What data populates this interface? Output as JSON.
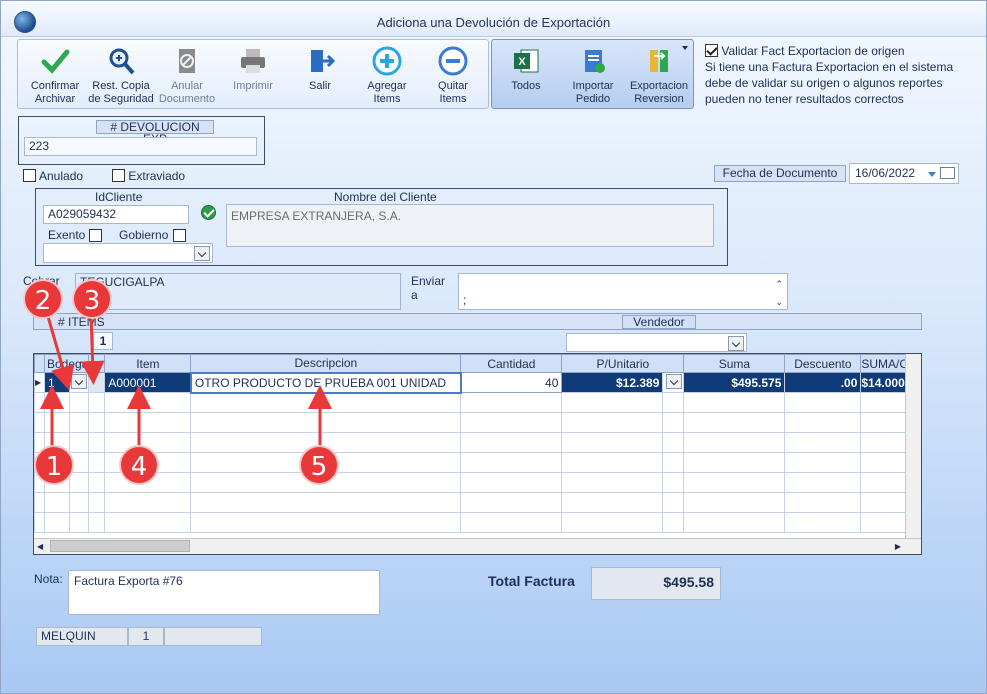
{
  "window": {
    "title": "Adiciona una Devolución de Exportación"
  },
  "toolbar": {
    "buttons": [
      {
        "label": "Confirmar\nArchivar",
        "icon": "check-icon"
      },
      {
        "label": "Rest. Copia\nde Seguridad",
        "icon": "magnify-icon"
      },
      {
        "label": "Anular\nDocumento",
        "icon": "void-document-icon"
      },
      {
        "label": "Imprimir",
        "icon": "printer-icon"
      },
      {
        "label": "Salir",
        "icon": "exit-door-icon"
      },
      {
        "label": "Agregar\nItems",
        "icon": "add-circle-icon"
      },
      {
        "label": "Quitar\nItems",
        "icon": "remove-circle-icon"
      }
    ],
    "buttons2": [
      {
        "label": "Todos",
        "icon": "excel-icon"
      },
      {
        "label": "Importar\nPedido",
        "icon": "import-order-icon"
      },
      {
        "label": "Exportacion\nReversion",
        "icon": "export-reversion-icon"
      }
    ]
  },
  "validate": {
    "checkbox_label": "Validar Fact Exportacion de origen",
    "note": "Si tiene una Factura Exportacion en el sistema debe de validar su origen o algunos reportes pueden no tener resultados correctos"
  },
  "devolucion": {
    "label": "# DEVOLUCION EXP",
    "value": "223"
  },
  "flags": {
    "anulado": "Anulado",
    "extraviado": "Extraviado"
  },
  "fecha": {
    "label": "Fecha de  Documento",
    "value": "16/06/2022"
  },
  "cliente": {
    "id_label": "IdCliente",
    "id_value": "A029059432",
    "name_label": "Nombre del Cliente",
    "name_value": "EMPRESA EXTRANJERA, S.A.",
    "exento": "Exento",
    "gobierno": "Gobierno"
  },
  "cobrar": {
    "label": "Cobrar",
    "value": "TEGUCIGALPA"
  },
  "enviar": {
    "label": "Enviar\na",
    "value": ";"
  },
  "items": {
    "tab": "# ITEMS",
    "count": "1",
    "vendedor_label": "Vendedor",
    "columns": [
      "Bodega",
      "Item",
      "Descripcion",
      "Cantidad",
      "P/Unitario",
      "Suma",
      "Descuento",
      "SUMA/C"
    ],
    "rows": [
      {
        "bodega": "1",
        "item": "A000001",
        "descripcion": "OTRO PRODUCTO DE PRUEBA 001 UNIDAD",
        "cantidad": "40",
        "punitario": "$12.389",
        "suma": "$495.575",
        "descuento": ".00",
        "sumac": "$14.000"
      }
    ]
  },
  "nota": {
    "label": "Nota:",
    "value": "Factura Exporta #76"
  },
  "total": {
    "label": "Total Factura",
    "value": "$495.58"
  },
  "status": {
    "user": "MELQUIN",
    "num": "1"
  },
  "markers": [
    "1",
    "2",
    "3",
    "4",
    "5"
  ]
}
